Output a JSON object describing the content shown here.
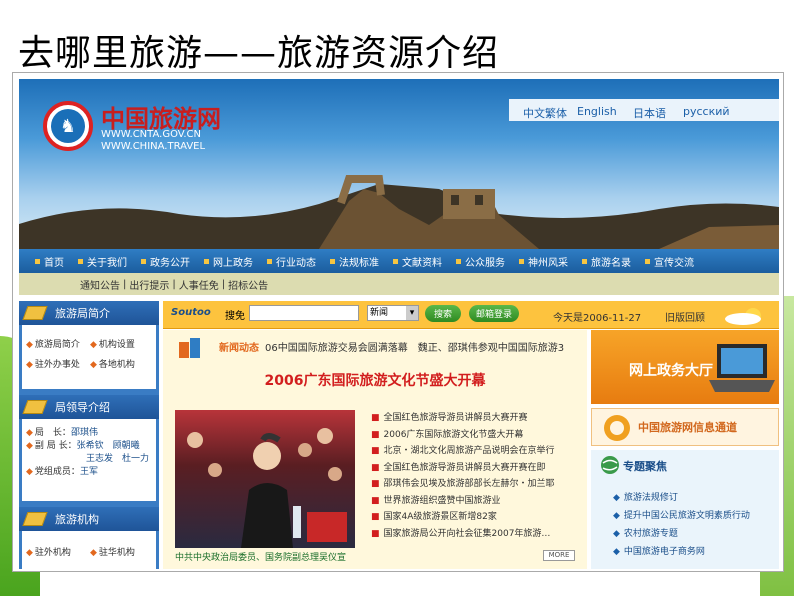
{
  "slide_title": "去哪里旅游——旅游资源介绍",
  "site": {
    "logo_name": "中国旅游网",
    "logo_urls": [
      "WWW.CNTA.GOV.CN",
      "WWW.CHINA.TRAVEL"
    ],
    "languages": [
      "中文繁体",
      "English",
      "日本语",
      "русский"
    ],
    "nav": [
      "首页",
      "关于我们",
      "政务公开",
      "网上政务",
      "行业动态",
      "法规标准",
      "文献资料",
      "公众服务",
      "神州风采",
      "旅游名录",
      "宣传交流"
    ],
    "subnav": [
      "通知公告",
      "出行提示",
      "人事任免",
      "招标公告"
    ],
    "left_boxes": [
      {
        "title": "旅游局简介",
        "items": [
          "旅游局简介",
          "机构设置",
          "驻外办事处",
          "各地机构"
        ]
      },
      {
        "title": "局领导介绍",
        "rows": [
          {
            "role": "局　长：",
            "names": "邵琪伟"
          },
          {
            "role": "副 局 长：",
            "names": "张希钦　顾朝曦"
          },
          {
            "role": "",
            "names": "王志发　杜一力"
          },
          {
            "role": "党组成员：",
            "names": "王军"
          }
        ]
      },
      {
        "title": "旅游机构",
        "items": [
          "驻外机构",
          "驻华机构"
        ]
      }
    ],
    "search": {
      "brand": "Soutoo",
      "label": "搜免",
      "select_value": "新闻",
      "search_button": "搜索",
      "mail_button": "邮箱登录",
      "today": "今天是2006-11-27",
      "old_link": "旧版回顾"
    },
    "news": {
      "ticker_label": "新闻动态",
      "ticker_text": "06中国国际旅游交易会圆满落幕　魏正、邵琪伟参观中国国际旅游3",
      "headline": "2006广东国际旅游文化节盛大开幕",
      "items": [
        "全国红色旅游导游员讲解员大赛开赛",
        "2006广东国际旅游文化节盛大开幕",
        "北京・湖北文化周旅游产品说明会在京举行",
        "全国红色旅游导游员讲解员大赛开赛在即",
        "邵琪伟会见埃及旅游部部长左赫尔・加兰耶",
        "世界旅游组织盛赞中国旅游业",
        "国家4A级旅游景区新增82家",
        "国家旅游局公开向社会征集2007年旅游…"
      ],
      "caption": "中共中央政治局委员、国务院副总理吴仪宣",
      "more": "MORE"
    },
    "right": {
      "gov_hall": "网上政务大厅",
      "info_channel": "中国旅游网信息通道",
      "topic_title": "专题聚焦",
      "topics": [
        "旅游法规修订",
        "提升中国公民旅游文明素质行动",
        "农村旅游专题",
        "中国旅游电子商务网"
      ]
    }
  }
}
